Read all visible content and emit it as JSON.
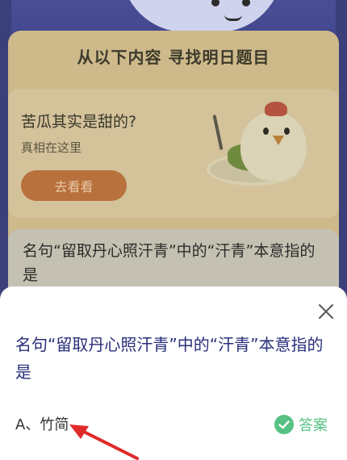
{
  "background": {
    "title": "从以下内容 寻找明日题目",
    "tip_card": {
      "question": "苦瓜其实是甜的?",
      "subtitle": "真相在这里",
      "button_label": "去看看"
    },
    "question_card": {
      "text": "名句“留取丹心照汗青”中的“汗青”本意指的是"
    }
  },
  "sheet": {
    "question": "名句“留取丹心照汗青”中的“汗青”本意指的是",
    "answer_text": "A、竹简",
    "answer_link_label": "答案",
    "close_icon": "close-icon",
    "check_icon": "check-circle-icon"
  },
  "colors": {
    "question_text": "#2a2f7a",
    "answer_green": "#57c183",
    "arrow_red": "#e02a2a",
    "overlay_dim": "#3b3f7a"
  }
}
